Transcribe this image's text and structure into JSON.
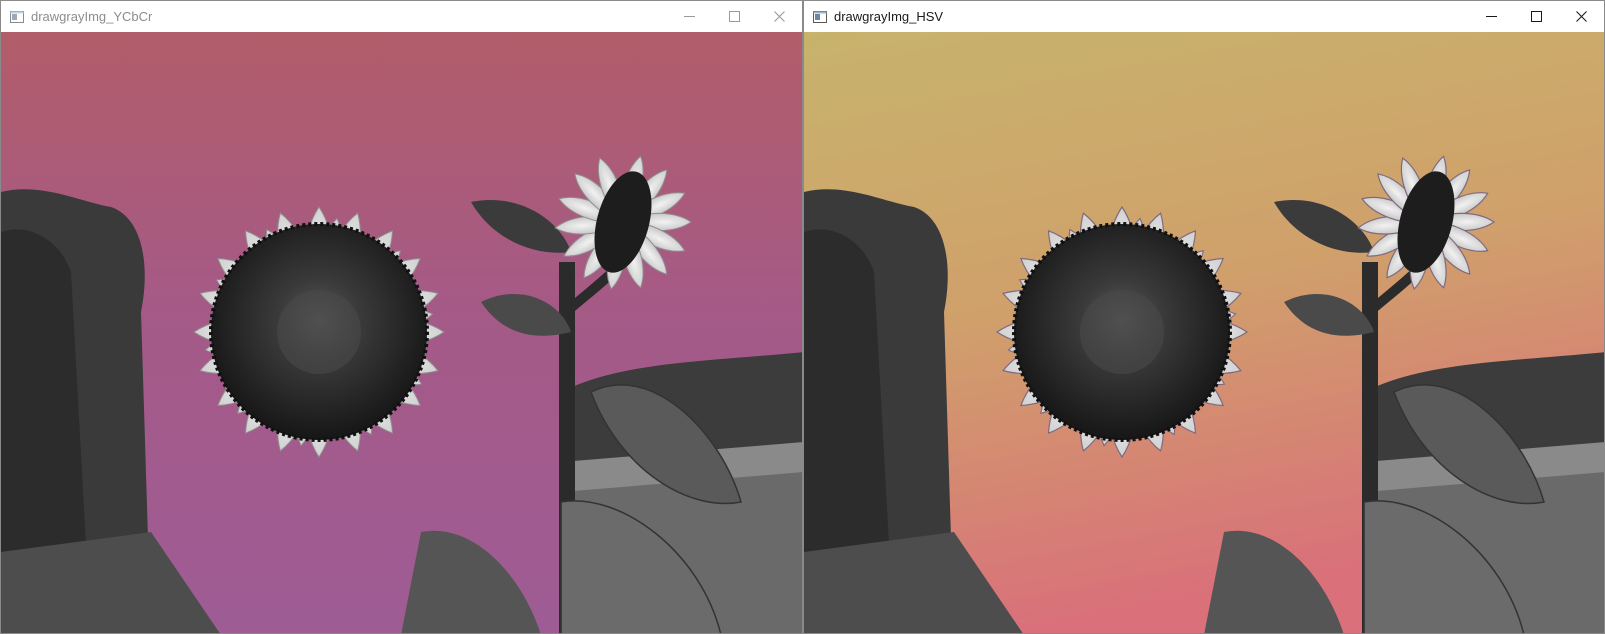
{
  "windows": {
    "left": {
      "title": "drawgrayImg_YCbCr",
      "icon": "app-window-icon",
      "controls": [
        "minimize-icon",
        "maximize-icon",
        "close-icon"
      ],
      "sky_colors": [
        "#b25d6a",
        "#a55a86",
        "#9e5c95"
      ]
    },
    "right": {
      "title": "drawgrayImg_HSV",
      "icon": "app-window-icon",
      "controls": [
        "minimize-icon",
        "maximize-icon",
        "close-icon"
      ],
      "sky_colors": [
        "#c7b36c",
        "#d0a06b",
        "#d9707a"
      ]
    }
  }
}
